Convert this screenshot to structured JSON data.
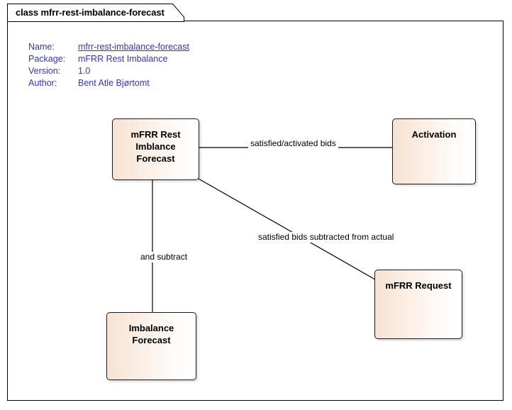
{
  "diagram": {
    "tab_title": "class mfrr-rest-imbalance-forecast",
    "metadata": [
      {
        "key": "Name:",
        "value": "mfrr-rest-imbalance-forecast"
      },
      {
        "key": "Package:",
        "value": "mFRR Rest Imbalance"
      },
      {
        "key": "Version:",
        "value": "1.0"
      },
      {
        "key": "Author:",
        "value": "Bent Atle Bjørtomt"
      }
    ],
    "nodes": [
      {
        "id": "mfrr-rest-imbalance-forecast",
        "name": "mFRR Rest\nImblance\nForecast"
      },
      {
        "id": "activation",
        "name": "Activation"
      },
      {
        "id": "mfrr-request",
        "name": "mFRR Request"
      },
      {
        "id": "imbalance-forecast",
        "name": "Imbalance\nForecast"
      }
    ],
    "edges": [
      {
        "id": "satisfied-activated-bids",
        "label": "satisfied/activated bids"
      },
      {
        "id": "satisfied-bids-subtracted",
        "label": "satisfied bids subtracted from actual"
      },
      {
        "id": "and-subtract",
        "label": "and subtract"
      }
    ],
    "colors": {
      "metadata_text": "#3333cc",
      "node_fill_start": "#f7e2d2",
      "node_fill_end": "#ffffff",
      "node_border": "#1a1a1a",
      "line": "#000000"
    }
  }
}
